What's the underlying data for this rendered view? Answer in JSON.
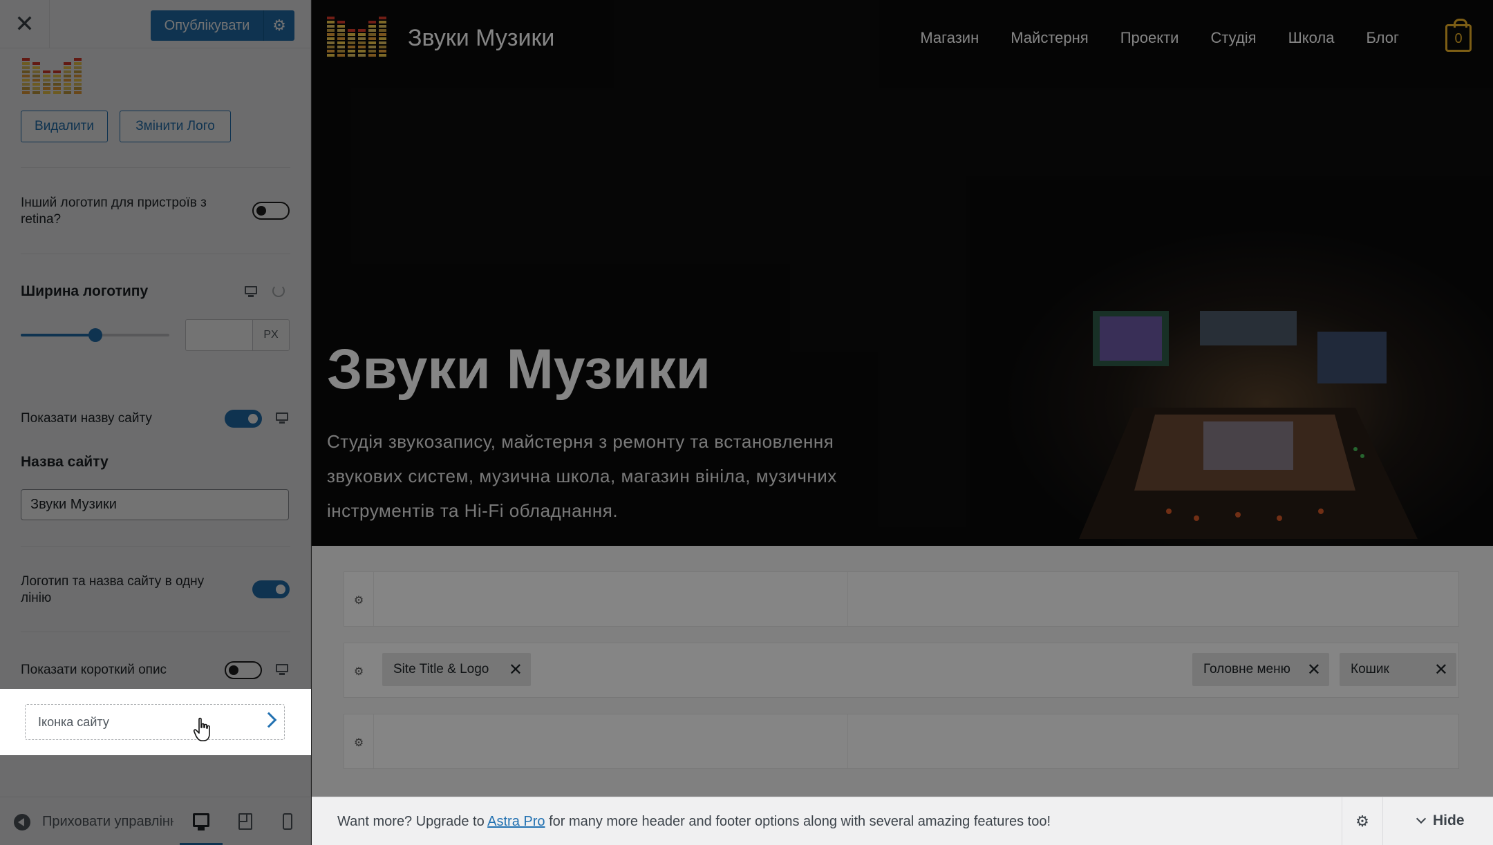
{
  "colors": {
    "accent": "#2271b1",
    "cart": "#f0b429",
    "hero_bg": "#0b0b0b"
  },
  "panel": {
    "publish_label": "Опублікувати",
    "logo": {
      "remove_label": "Видалити",
      "change_label": "Змінити Лого"
    },
    "retina": {
      "label": "Інший логотип для пристроїв з retina?",
      "enabled": false
    },
    "logo_width": {
      "title": "Ширина логотипу",
      "value_fraction": 0.5,
      "input_value": "",
      "unit": "PX"
    },
    "show_site_title": {
      "label": "Показати назву сайту",
      "enabled": true
    },
    "site_title": {
      "heading": "Назва сайту",
      "value": "Звуки Музики"
    },
    "inline_logo": {
      "label": "Логотип та назва сайту в одну лінію",
      "enabled": true
    },
    "show_tagline": {
      "label": "Показати короткий опис",
      "enabled": false
    },
    "site_icon": {
      "label": "Іконка сайту"
    },
    "footer": {
      "hide_controls_label": "Приховати управління"
    }
  },
  "preview": {
    "site_title": "Звуки Музики",
    "nav": [
      "Магазин",
      "Майстерня",
      "Проекти",
      "Студія",
      "Школа",
      "Блог"
    ],
    "cart_count": "0",
    "hero": {
      "title": "Звуки Музики",
      "description": "Студія звукозапису, майстерня з ремонту та встановлення звукових систем, музична школа, магазин вініла, музичних інструментів та Hi-Fi обладнання."
    },
    "builder": {
      "chips": {
        "site_title_logo": "Site Title & Logo",
        "main_menu": "Головне меню",
        "cart": "Кошик"
      }
    },
    "upgrade": {
      "text_before": "Want more? Upgrade to ",
      "link": "Astra Pro",
      "text_after": " for many more header and footer options along with several amazing features too!",
      "hide_label": "Hide"
    }
  }
}
